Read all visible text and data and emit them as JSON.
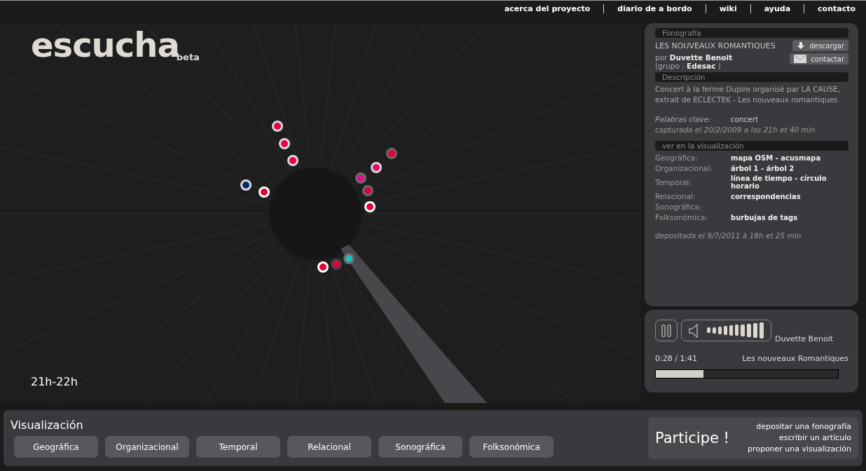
{
  "nav": [
    {
      "label": "acerca del proyecto"
    },
    {
      "label": "diario de a bordo"
    },
    {
      "label": "wiki"
    },
    {
      "label": "ayuda"
    },
    {
      "label": "contacto"
    }
  ],
  "visualization": {
    "logo": "escucha",
    "badge": "beta",
    "time_label": "21h-22h",
    "dots": [
      {
        "color": "#e8003a",
        "kind": "pale",
        "selected": false
      },
      {
        "color": "#e8003a",
        "kind": "pale",
        "selected": false
      },
      {
        "color": "#e8003a",
        "kind": "pale",
        "selected": false
      },
      {
        "color": "#0a2a5a",
        "kind": "pale",
        "selected": false
      },
      {
        "color": "#e8003a",
        "kind": "white",
        "selected": false
      },
      {
        "color": "#e8003a",
        "kind": "grey",
        "selected": false
      },
      {
        "color": "#e0105a",
        "kind": "pale",
        "selected": false
      },
      {
        "color": "#e0108a",
        "kind": "grey",
        "selected": false
      },
      {
        "color": "#e0003a",
        "kind": "grey",
        "selected": false
      },
      {
        "color": "#e8003a",
        "kind": "white",
        "selected": false
      },
      {
        "color": "#e8003a",
        "kind": "white",
        "selected": false
      },
      {
        "color": "#e8003a",
        "kind": "dark",
        "selected": false
      },
      {
        "color": "#18c0c8",
        "kind": "grey",
        "selected": true
      }
    ]
  },
  "info": {
    "section_title": "Fonografía",
    "title": "LES NOUVEAUX ROMANTIQUES",
    "download": "descargar",
    "contact": "contactar",
    "author": "por **Duvette Benoit**",
    "group": "(grupo : **Edesac** )",
    "description_title": "Descripción",
    "description": "Concert à la ferme Dupire organisé par LA CAUSE, extrait de ECLECTEK - Les nouveaux romantiques",
    "keywords_label": "Palabras clave:",
    "keywords": "concert",
    "captured": "capturada el 20/2/2009 a las 21h et 40 min",
    "views_title": "ver en la visualización",
    "views": [
      {
        "label": "Geográfica:",
        "value": "mapa OSM  - acusmapa"
      },
      {
        "label": "Organizacional:",
        "value": "árbol 1  - árbol 2"
      },
      {
        "label": "Temporal:",
        "value": "línea de tiempo  - círculo horario"
      },
      {
        "label": "Relacional:",
        "value": "correspondencias"
      },
      {
        "label": "Sonográfica:"
      },
      {
        "label": "Folksonómica:",
        "value": "burbujas de tags"
      }
    ],
    "deposited": "depositada el 9/7/2011 à 18h et 25 min"
  },
  "player": {
    "volume": {
      "level": 1
    },
    "artist": "Duvette Benoit",
    "time": "0:28 / 1:41",
    "track": "Les nouveaux Romantiques",
    "progress": {
      "level": 0.26
    }
  },
  "footer": {
    "title": "Visualización",
    "buttons": [
      {
        "label": "Geográfica"
      },
      {
        "label": "Organizacional"
      },
      {
        "label": "Temporal"
      },
      {
        "label": "Relacional"
      },
      {
        "label": "Sonográfica"
      },
      {
        "label": "Folksonómica"
      }
    ],
    "participate": {
      "title": "Participe !",
      "links": [
        {
          "label": "depositar una fonografía"
        },
        {
          "label": "escribir un artículo"
        },
        {
          "label": "proponer una visualización"
        }
      ]
    }
  }
}
